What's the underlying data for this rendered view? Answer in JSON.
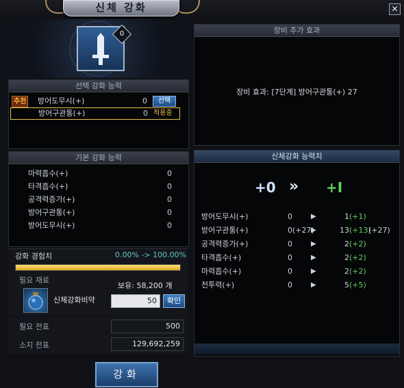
{
  "window": {
    "title": "신체 강화",
    "close_glyph": "✕"
  },
  "icon": {
    "badge": "0"
  },
  "selected_ability": {
    "header": "선택 강화 능력",
    "rows": [
      {
        "tag": "추천",
        "name": "방어도무시(+)",
        "value": "0",
        "action": "선택"
      },
      {
        "tag": "",
        "name": "방어구관통(+)",
        "value": "0",
        "action": "적용중"
      }
    ]
  },
  "base_ability": {
    "header": "기본 강화 능력",
    "rows": [
      {
        "name": "마력흡수(+)",
        "value": "0"
      },
      {
        "name": "타격흡수(+)",
        "value": "0"
      },
      {
        "name": "공격력증가(+)",
        "value": "0"
      },
      {
        "name": "방어구관통(+)",
        "value": "0"
      },
      {
        "name": "방어도무시(+)",
        "value": "0"
      }
    ]
  },
  "experience": {
    "label": "강화 경험치",
    "value": "0.00% -> 100.00%",
    "fill": 1.0
  },
  "material": {
    "label": "필요 재료",
    "owned": "보유: 58,200 개",
    "item_name": "신체강화비약",
    "quantity": "50",
    "confirm": "확인"
  },
  "cost": {
    "required_label": "필요 전표",
    "required_value": "500",
    "owned_label": "소지 전표",
    "owned_value": "129,692,259"
  },
  "enhance_button": "강화",
  "equip_effect": {
    "header": "장비 추가 효과",
    "text": "장비 효과: [7단계] 방어구관통(+) 27"
  },
  "stats": {
    "header": "신체강화 능력치",
    "from_level": "+0",
    "arrows": "»",
    "to_level": "+I",
    "arrow_glyph": "▶",
    "rows": [
      {
        "name": "방어도무시(+)",
        "before": "0",
        "after": "1",
        "delta": "(+1)",
        "extra": ""
      },
      {
        "name": "방어구관통(+)",
        "before": "0(+27)",
        "after": "13",
        "delta": "(+13)",
        "extra": "(+27)"
      },
      {
        "name": "공격력증가(+)",
        "before": "0",
        "after": "2",
        "delta": "(+2)",
        "extra": ""
      },
      {
        "name": "타격흡수(+)",
        "before": "0",
        "after": "2",
        "delta": "(+2)",
        "extra": ""
      },
      {
        "name": "마력흡수(+)",
        "before": "0",
        "after": "2",
        "delta": "(+2)",
        "extra": ""
      },
      {
        "name": "전투력(+)",
        "before": "0",
        "after": "5",
        "delta": "(+5)",
        "extra": ""
      }
    ]
  },
  "colors": {
    "accent_blue": "#2e5f9c",
    "highlight_yellow": "#e8c44a",
    "green": "#5fd35f",
    "recommend_tag": "#f0a030"
  }
}
